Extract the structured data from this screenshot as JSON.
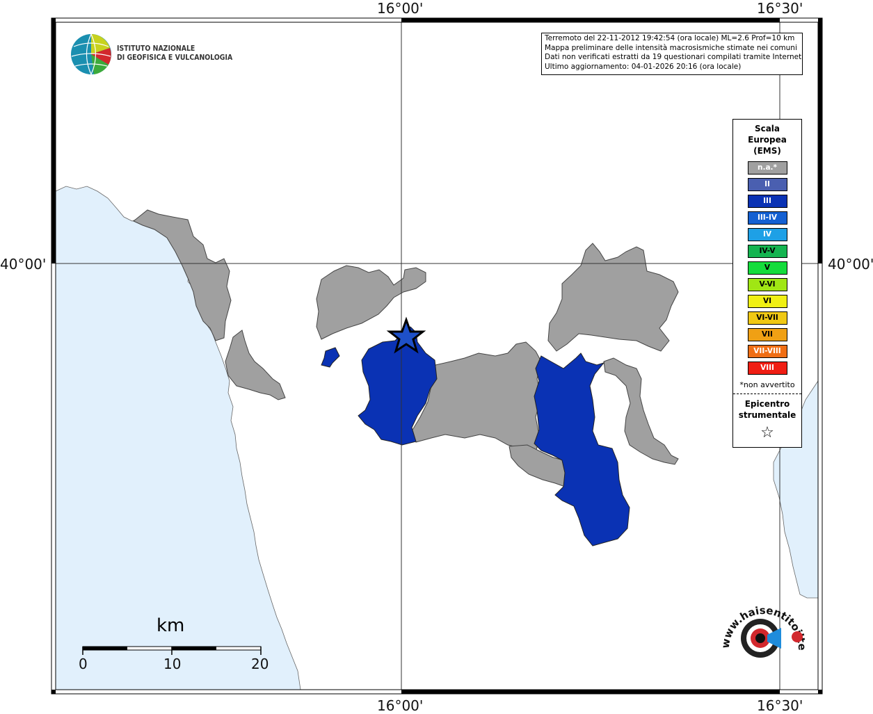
{
  "map": {
    "coords": {
      "top_lon_1": "16°00'",
      "top_lon_2": "16°30'",
      "bottom_lon_1": "16°00'",
      "bottom_lon_2": "16°30'",
      "left_lat": "40°00'",
      "right_lat": "40°00'"
    },
    "institute": {
      "line1": "ISTITUTO NAZIONALE",
      "line2": "DI GEOFISICA E VULCANOLOGIA"
    },
    "info": {
      "line1": "Terremoto del 22-11-2012 19:42:54 (ora locale) ML=2.6 Prof=10 km",
      "line2": "Mappa preliminare delle intensità macrosismiche stimate nei comuni",
      "line3": "Dati non verificati estratti da 19 questionari compilati tramite Internet.",
      "line4": "Ultimo aggiornamento: 04-01-2026 20:16 (ora locale)"
    },
    "legend": {
      "title_line1": "Scala",
      "title_line2": "Europea",
      "title_line3": "(EMS)",
      "levels": [
        {
          "label": "n.a.*",
          "color": "#a0a0a0"
        },
        {
          "label": "II",
          "color": "#4a5fb0"
        },
        {
          "label": "III",
          "color": "#0a32b4"
        },
        {
          "label": "III-IV",
          "color": "#1460d2"
        },
        {
          "label": "IV",
          "color": "#1ea0e6"
        },
        {
          "label": "IV-V",
          "color": "#14b450"
        },
        {
          "label": "V",
          "color": "#14dc3c"
        },
        {
          "label": "V-VI",
          "color": "#a0e614"
        },
        {
          "label": "VI",
          "color": "#f0f014"
        },
        {
          "label": "VI-VII",
          "color": "#f0c814"
        },
        {
          "label": "VII",
          "color": "#f0a014"
        },
        {
          "label": "VII-VIII",
          "color": "#f06e14"
        },
        {
          "label": "VIII",
          "color": "#f01e14"
        }
      ],
      "note": "*non avvertito",
      "epicenter_line1": "Epicentro",
      "epicenter_line2": "strumentale",
      "epicenter_symbol": "☆"
    },
    "scalebar": {
      "unit": "km",
      "ticks": [
        "0",
        "10",
        "20"
      ]
    },
    "logo": {
      "text": "www.haisentitoilterremoto.it"
    },
    "colors": {
      "sea": "#e1f0fc",
      "not_felt": "#a0a0a0",
      "intensity_III": "#0a32b4"
    }
  }
}
